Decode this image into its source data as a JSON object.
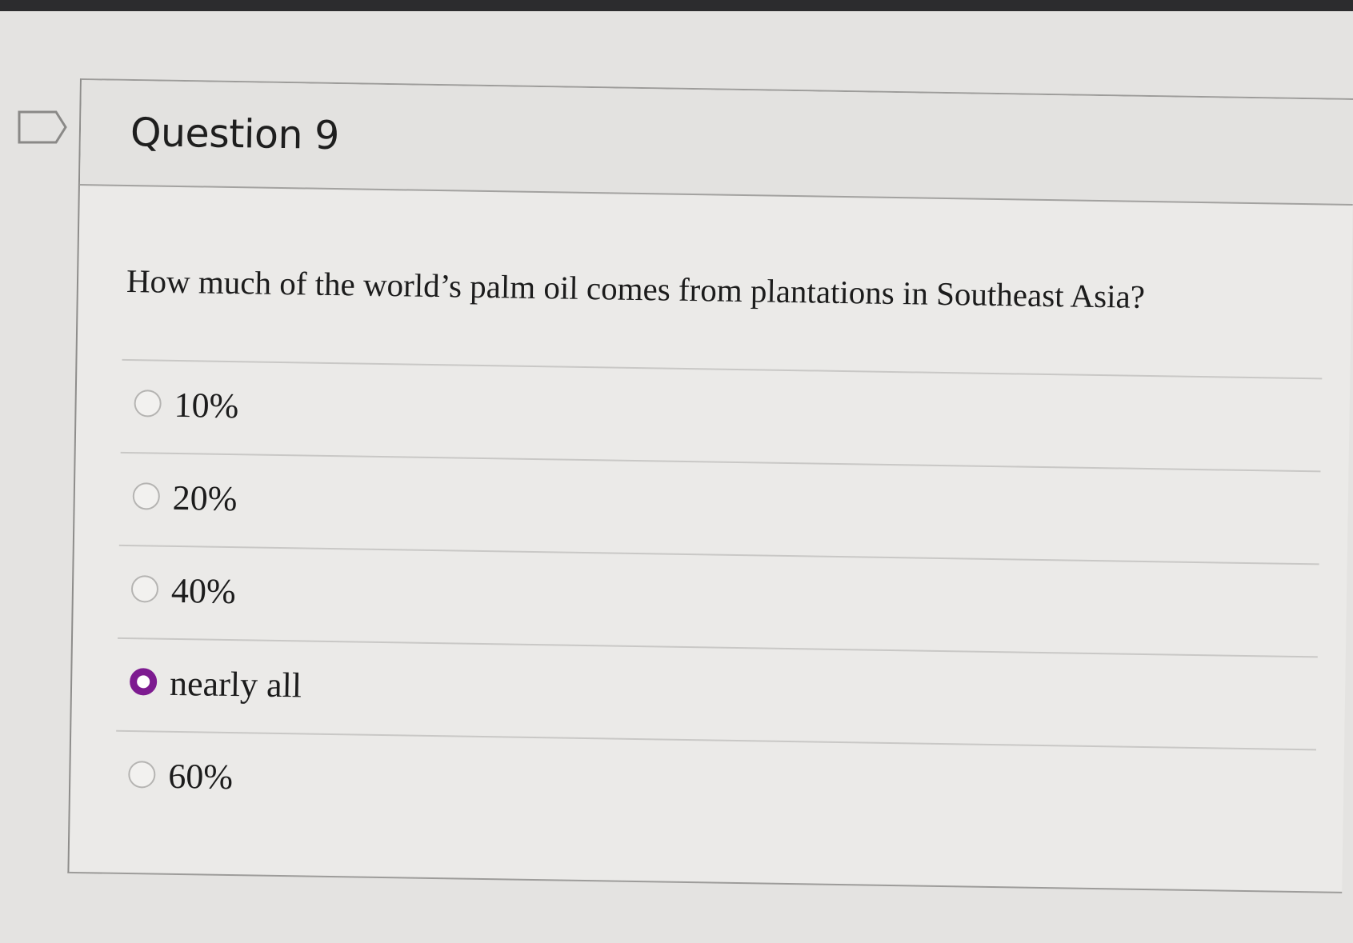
{
  "question": {
    "title": "Question 9",
    "text": "How much of the world’s palm oil comes from plantations in Southeast Asia?",
    "flag_icon": "flag-outline-icon"
  },
  "answers": [
    {
      "label": "10%",
      "selected": false
    },
    {
      "label": "20%",
      "selected": false
    },
    {
      "label": "40%",
      "selected": false
    },
    {
      "label": "nearly all",
      "selected": true
    },
    {
      "label": "60%",
      "selected": false
    }
  ],
  "colors": {
    "selected_radio": "#7d1b90",
    "background": "#e4e3e1"
  }
}
